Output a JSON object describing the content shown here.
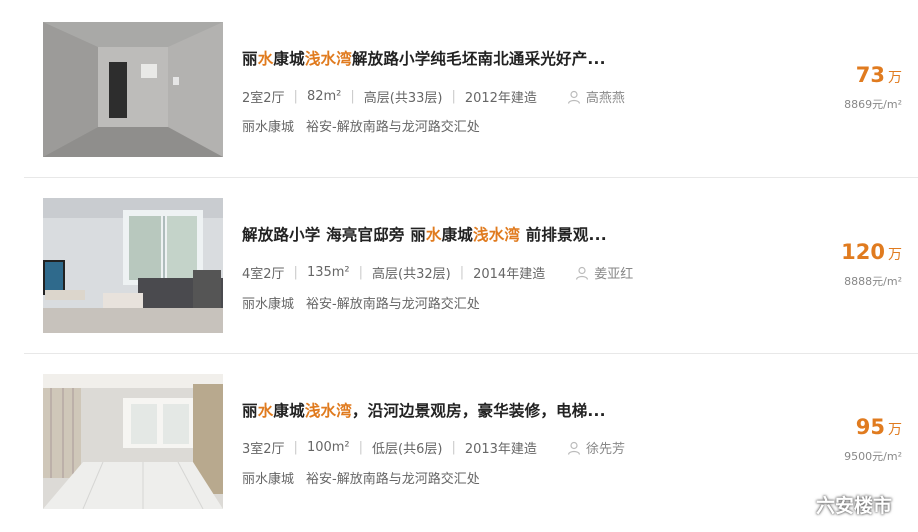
{
  "listings": [
    {
      "title_parts": [
        "丽",
        "水",
        "康城",
        "浅水湾",
        "解放路小学纯毛坯南北通采光好产..."
      ],
      "layout": "2室2厅",
      "area": "82m²",
      "floor": "高层(共33层)",
      "year": "2012年建造",
      "agent": "高燕燕",
      "community": "丽水康城",
      "address": "裕安-解放南路与龙河路交汇处",
      "price": "73",
      "price_unit": "万",
      "unit_price": "8869元/m²",
      "photo_icon": "unfinished-apartment-photo"
    },
    {
      "title_parts": [
        "解放路小学 海亮官邸旁 丽",
        "水",
        "康城",
        "浅水湾",
        " 前排景观..."
      ],
      "layout": "4室2厅",
      "area": "135m²",
      "floor": "高层(共32层)",
      "year": "2014年建造",
      "agent": "姜亚红",
      "community": "丽水康城",
      "address": "裕安-解放南路与龙河路交汇处",
      "price": "120",
      "price_unit": "万",
      "unit_price": "8888元/m²",
      "photo_icon": "living-room-photo"
    },
    {
      "title_parts": [
        "丽",
        "水",
        "康城",
        "浅水湾",
        "，沿河边景观房，豪华装修，电梯..."
      ],
      "layout": "3室2厅",
      "area": "100m²",
      "floor": "低层(共6层)",
      "year": "2013年建造",
      "agent": "徐先芳",
      "community": "丽水康城",
      "address": "裕安-解放南路与龙河路交汇处",
      "price": "95",
      "price_unit": "万",
      "unit_price": "9500元/m²",
      "photo_icon": "tiled-hall-photo"
    }
  ],
  "watermark": {
    "text": "六安楼市",
    "icon": "wechat-icon"
  },
  "colors": {
    "highlight": "#e07b1f",
    "text": "#222222",
    "meta": "#666666"
  }
}
